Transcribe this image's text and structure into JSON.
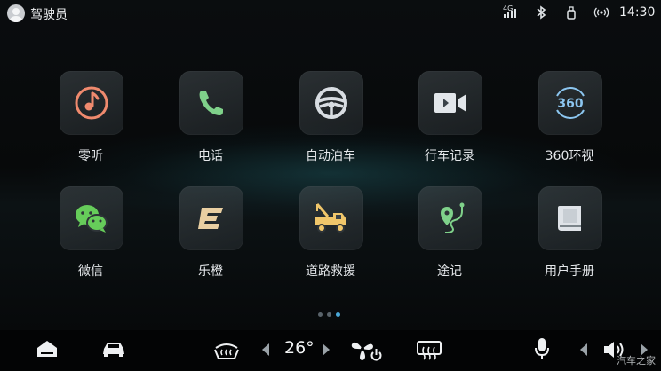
{
  "status_bar": {
    "user": "驾驶员",
    "network": "4G",
    "time": "14:30"
  },
  "apps": [
    {
      "label": "零听",
      "icon": "music-icon",
      "color": "#f08a6e"
    },
    {
      "label": "电话",
      "icon": "phone-icon",
      "color": "#7fd18a"
    },
    {
      "label": "自动泊车",
      "icon": "steering-wheel-icon",
      "color": "#d8dde2"
    },
    {
      "label": "行车记录",
      "icon": "video-camera-icon",
      "color": "#e2e6ea"
    },
    {
      "label": "360环视",
      "icon": "360-view-icon",
      "color": "#8cc6f0"
    },
    {
      "label": "微信",
      "icon": "wechat-icon",
      "color": "#66cc5a"
    },
    {
      "label": "乐橙",
      "icon": "lecheng-icon",
      "color": "#e9cfa2"
    },
    {
      "label": "道路救援",
      "icon": "tow-truck-icon",
      "color": "#f0c66a"
    },
    {
      "label": "途记",
      "icon": "route-icon",
      "color": "#7fd18a"
    },
    {
      "label": "用户手册",
      "icon": "manual-book-icon",
      "color": "#dfe3e8"
    }
  ],
  "pager": {
    "count": 3,
    "active": 2
  },
  "dock": {
    "temperature": "26°"
  },
  "watermark": "汽车之家"
}
